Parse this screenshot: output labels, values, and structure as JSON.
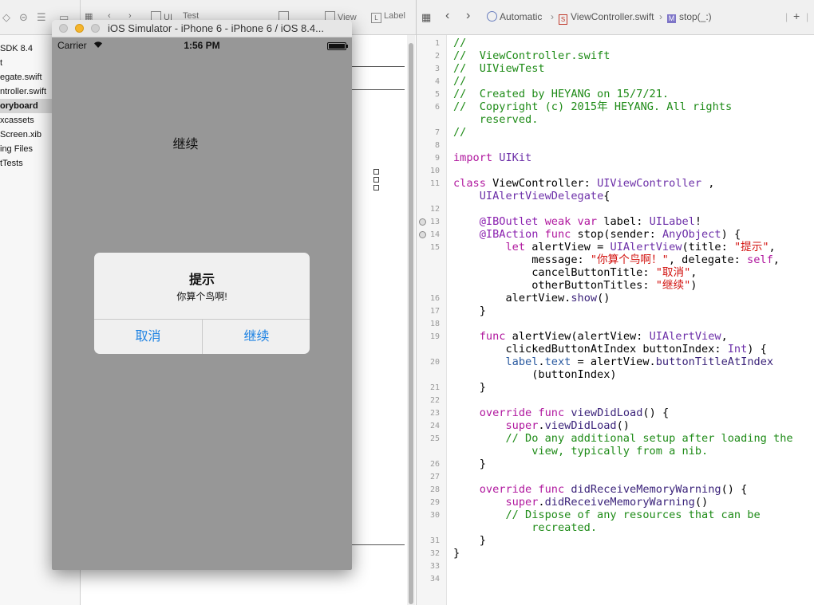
{
  "left_nav": {
    "items": [
      {
        "label": "SDK 8.4",
        "selected": false
      },
      {
        "label": "t",
        "selected": false
      },
      {
        "label": "egate.swift",
        "selected": false
      },
      {
        "label": "ntroller.swift",
        "selected": false
      },
      {
        "label": "oryboard",
        "selected": true
      },
      {
        "label": "xcassets",
        "selected": false
      },
      {
        "label": "Screen.xib",
        "selected": false
      },
      {
        "label": "ing Files",
        "selected": false
      },
      {
        "label": "tTests",
        "selected": false
      }
    ]
  },
  "canvas_jump": {
    "items": [
      "UI",
      "Test",
      "View",
      "Label"
    ]
  },
  "simulator": {
    "window_title": "iOS Simulator - iPhone 6 - iPhone 6 / iOS 8.4...",
    "carrier": "Carrier",
    "time": "1:56 PM",
    "battery_level": 1.0,
    "screen_label": "继续",
    "alert": {
      "title": "提示",
      "message": "你算个鸟啊!",
      "cancel_button": "取消",
      "other_button": "继续"
    }
  },
  "editor": {
    "jump_bar": {
      "automatic": "Automatic",
      "file": "ViewController.swift",
      "symbol_badge": "M",
      "symbol": "stop(_:)"
    },
    "breakpoint_lines": [
      13,
      14
    ],
    "lines": [
      {
        "num": "1",
        "text": "//"
      },
      {
        "num": "2",
        "text": "//  ViewController.swift"
      },
      {
        "num": "3",
        "text": "//  UIViewTest"
      },
      {
        "num": "4",
        "text": "//"
      },
      {
        "num": "5",
        "text": "//  Created by HEYANG on 15/7/21."
      },
      {
        "num": "6",
        "text": "//  Copyright (c) 2015年 HEYANG. All rights"
      },
      {
        "num": "",
        "text": "    reserved."
      },
      {
        "num": "7",
        "text": "//"
      },
      {
        "num": "8",
        "text": ""
      },
      {
        "num": "9",
        "text": "import UIKit"
      },
      {
        "num": "10",
        "text": ""
      },
      {
        "num": "11",
        "text": "class ViewController: UIViewController ,"
      },
      {
        "num": "",
        "text": "    UIAlertViewDelegate{"
      },
      {
        "num": "12",
        "text": ""
      },
      {
        "num": "13",
        "text": "    @IBOutlet weak var label: UILabel!"
      },
      {
        "num": "14",
        "text": "    @IBAction func stop(sender: AnyObject) {"
      },
      {
        "num": "15",
        "text": "        let alertView = UIAlertView(title: \"提示\","
      },
      {
        "num": "",
        "text": "            message: \"你算个鸟啊！\", delegate: self,"
      },
      {
        "num": "",
        "text": "            cancelButtonTitle: \"取消\","
      },
      {
        "num": "",
        "text": "            otherButtonTitles: \"继续\")"
      },
      {
        "num": "16",
        "text": "        alertView.show()"
      },
      {
        "num": "17",
        "text": "    }"
      },
      {
        "num": "18",
        "text": ""
      },
      {
        "num": "19",
        "text": "    func alertView(alertView: UIAlertView,"
      },
      {
        "num": "",
        "text": "        clickedButtonAtIndex buttonIndex: Int) {"
      },
      {
        "num": "20",
        "text": "        label.text = alertView.buttonTitleAtIndex"
      },
      {
        "num": "",
        "text": "            (buttonIndex)"
      },
      {
        "num": "21",
        "text": "    }"
      },
      {
        "num": "22",
        "text": ""
      },
      {
        "num": "23",
        "text": "    override func viewDidLoad() {"
      },
      {
        "num": "24",
        "text": "        super.viewDidLoad()"
      },
      {
        "num": "25",
        "text": "        // Do any additional setup after loading the"
      },
      {
        "num": "",
        "text": "            view, typically from a nib."
      },
      {
        "num": "26",
        "text": "    }"
      },
      {
        "num": "27",
        "text": ""
      },
      {
        "num": "28",
        "text": "    override func didReceiveMemoryWarning() {"
      },
      {
        "num": "29",
        "text": "        super.didReceiveMemoryWarning()"
      },
      {
        "num": "30",
        "text": "        // Dispose of any resources that can be"
      },
      {
        "num": "",
        "text": "            recreated."
      },
      {
        "num": "31",
        "text": "    }"
      },
      {
        "num": "32",
        "text": "}"
      },
      {
        "num": "33",
        "text": ""
      },
      {
        "num": "34",
        "text": ""
      }
    ]
  },
  "colors": {
    "comment": "#1e8b17",
    "keyword": "#b0179e",
    "type": "#6c2fa8",
    "string": "#d2120f",
    "alert_button": "#1d82e3",
    "simulator_screen": "#979797"
  }
}
